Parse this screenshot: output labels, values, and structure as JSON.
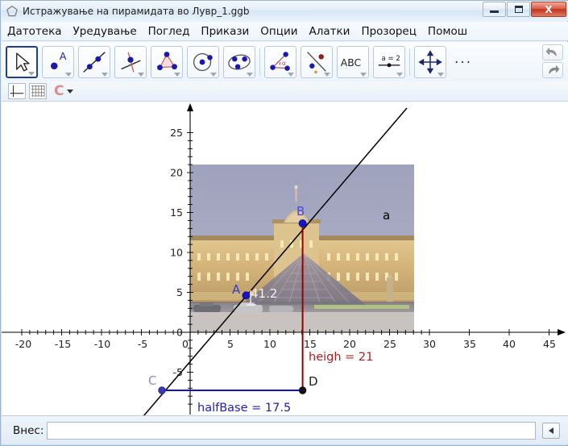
{
  "window": {
    "title": "Истражување на пирамидата во Лувр_1.ggb",
    "title_icon": "geogebra-icon",
    "controls": {
      "minimize": "minimize-button",
      "maximize": "maximize-button",
      "close_label": "X"
    }
  },
  "menu": {
    "items": [
      {
        "label": "Датотека",
        "name": "menu-file"
      },
      {
        "label": "Уредување",
        "name": "menu-edit"
      },
      {
        "label": "Поглед",
        "name": "menu-view"
      },
      {
        "label": "Прикази",
        "name": "menu-perspectives"
      },
      {
        "label": "Опции",
        "name": "menu-options"
      },
      {
        "label": "Алатки",
        "name": "menu-tools"
      },
      {
        "label": "Прозорец",
        "name": "menu-window"
      },
      {
        "label": "Помош",
        "name": "menu-help"
      }
    ]
  },
  "toolbar": {
    "tools": [
      {
        "name": "tool-move",
        "icon": "arrow-cursor-icon",
        "selected": true
      },
      {
        "name": "tool-point",
        "icon": "point-a-icon",
        "selected": false
      },
      {
        "name": "tool-line",
        "icon": "line-through-two-points-icon",
        "selected": false
      },
      {
        "name": "tool-perpendicular-line",
        "icon": "perpendicular-line-icon",
        "selected": false
      },
      {
        "name": "tool-polygon",
        "icon": "triangle-polygon-icon",
        "selected": false
      },
      {
        "name": "tool-circle",
        "icon": "circle-center-point-icon",
        "selected": false
      },
      {
        "name": "tool-ellipse",
        "icon": "ellipse-conic-icon",
        "selected": false
      },
      {
        "name": "tool-angle",
        "icon": "angle-measure-icon",
        "selected": false
      },
      {
        "name": "tool-reflect",
        "icon": "reflect-about-line-icon",
        "selected": false
      },
      {
        "name": "tool-text",
        "icon": "abc-text-icon",
        "selected": false
      },
      {
        "name": "tool-slider",
        "icon": "slider-a-equals-2-icon",
        "selected": false
      },
      {
        "name": "tool-move-graphics-view",
        "icon": "move-graphics-view-icon",
        "selected": false
      }
    ],
    "overflow_label": "...",
    "undo": {
      "name": "undo-button",
      "icon": "undo-arrow-icon"
    },
    "redo": {
      "name": "redo-button",
      "icon": "redo-arrow-icon"
    }
  },
  "stylebar": {
    "axes_toggle": "show-axes-icon",
    "grid_toggle": "show-grid-icon",
    "capture_letter": "C",
    "dropdown": "chevron-down-icon"
  },
  "chart_data": {
    "type": "scatter",
    "title": "",
    "xlabel": "",
    "ylabel": "",
    "xlim": [
      -22,
      47
    ],
    "ylim": [
      -9,
      28
    ],
    "xticks": [
      -20,
      -15,
      -10,
      -5,
      0,
      5,
      10,
      15,
      20,
      25,
      30,
      35,
      40,
      45
    ],
    "yticks": [
      25,
      20,
      15,
      10,
      5,
      0,
      -5
    ],
    "grid": false,
    "background_image": {
      "name": "louvre-pyramid-photo",
      "x_range": [
        0,
        28
      ],
      "y_range": [
        0,
        21
      ]
    },
    "points": [
      {
        "label": "A",
        "x": 7.0,
        "y": 4.6,
        "color": "#0000cc",
        "filled": true
      },
      {
        "label": "B",
        "x": 14.0,
        "y": 13.6,
        "color": "#0000cc",
        "filled": true
      },
      {
        "label": "C",
        "x": -3.5,
        "y": -7.0,
        "color": "#3333bb",
        "filled": true
      },
      {
        "label": "D",
        "x": 14.0,
        "y": -7.0,
        "color": "#111111",
        "filled": true
      }
    ],
    "objects": [
      {
        "name": "line-a",
        "label": "a",
        "type": "line",
        "color": "#000000",
        "from": [
          -5.0,
          -10.0
        ],
        "to": [
          30.2,
          28.0
        ]
      },
      {
        "name": "segment-height",
        "type": "segment",
        "color": "#990000",
        "from": [
          14.0,
          13.6
        ],
        "to": [
          14.0,
          -7.0
        ]
      },
      {
        "name": "segment-halfbase",
        "type": "segment",
        "color": "#0000cc",
        "from": [
          -3.5,
          -7.0
        ],
        "to": [
          14.0,
          -7.0
        ]
      }
    ],
    "annotations": [
      {
        "name": "slope-label",
        "text": "41.2",
        "x": 8.2,
        "y": 4.9,
        "color": "#f0f0f0"
      },
      {
        "name": "height-label",
        "text": "heigh = 21",
        "x": 14.6,
        "y": -4.4,
        "color": "#aa2222"
      },
      {
        "name": "halfbase-label",
        "text": "halfBase = 17.5",
        "x": 0.5,
        "y": -9.2,
        "color": "#2222aa"
      }
    ]
  },
  "input": {
    "label": "Внес:",
    "value": "",
    "placeholder": "",
    "submit_icon": "left-triangle-icon"
  }
}
